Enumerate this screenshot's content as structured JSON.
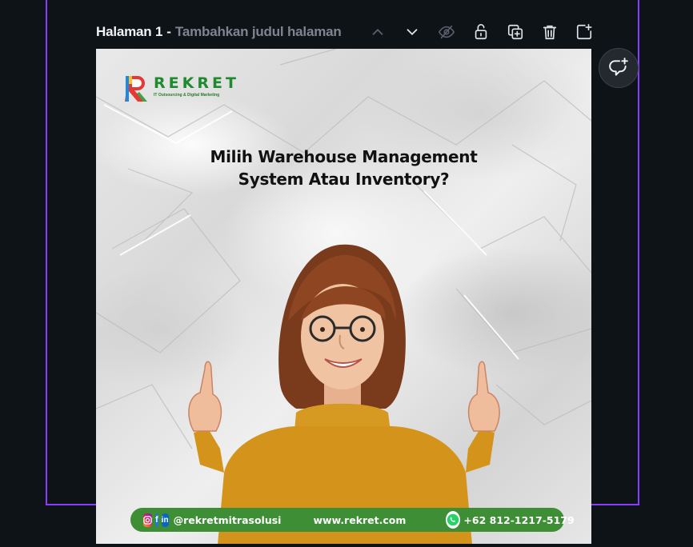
{
  "toolbar": {
    "page_label": "Halaman 1",
    "separator": "-",
    "page_title_placeholder": "Tambahkan judul halaman",
    "icons": [
      "chevron-up-icon",
      "chevron-down-icon",
      "eye-off-icon",
      "unlock-icon",
      "duplicate-icon",
      "trash-icon",
      "add-page-icon"
    ]
  },
  "comment_button": {
    "icon": "add-comment-icon"
  },
  "design": {
    "logo_name": "REKRET",
    "logo_tagline": "IT Outsourcing & Digital Marketing",
    "headline_line1": "Milih Warehouse Management",
    "headline_line2": "System Atau Inventory?",
    "footer": {
      "social_handle": "@rekretmitrasolusi",
      "website": "www.rekret.com",
      "phone": "+62 812-1217-5179",
      "social_icons": [
        "instagram-icon",
        "facebook-icon",
        "linkedin-icon"
      ],
      "phone_icon": "whatsapp-icon"
    }
  },
  "colors": {
    "frame_border": "#8b3dff",
    "app_background": "#0e1318",
    "footer_green": "#3e8e35",
    "sweater": "#d4941c"
  }
}
